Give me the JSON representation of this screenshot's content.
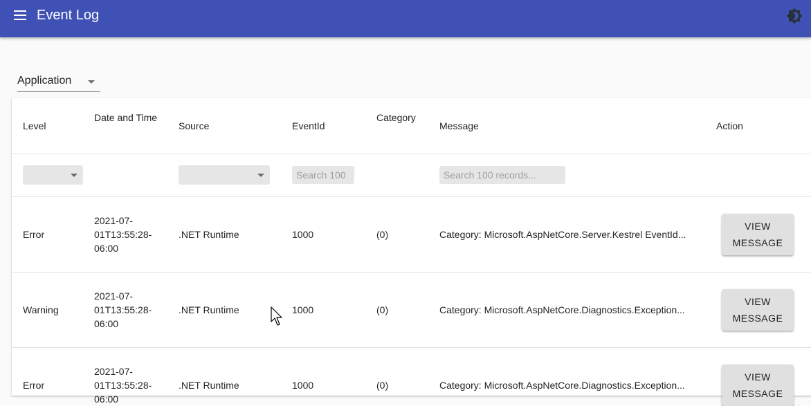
{
  "app": {
    "title": "Event Log"
  },
  "log_selector": {
    "value": "Application"
  },
  "table": {
    "headers": {
      "level": "Level",
      "date": "Date and Time",
      "source": "Source",
      "eventid": "EventId",
      "category": "Category",
      "message": "Message",
      "action": "Action"
    },
    "filters": {
      "eventid_placeholder": "Search 100",
      "message_placeholder": "Search 100 records..."
    },
    "rows": [
      {
        "level": "Error",
        "date_line1": "2021-07-",
        "date_line2": "01T13:55:28-",
        "date_line3": "06:00",
        "source": ".NET Runtime",
        "eventid": "1000",
        "category": "(0)",
        "message": "Category: Microsoft.AspNetCore.Server.Kestrel EventId...",
        "action_line1": "VIEW",
        "action_line2": "MESSAGE"
      },
      {
        "level": "Warning",
        "date_line1": "2021-07-",
        "date_line2": "01T13:55:28-",
        "date_line3": "06:00",
        "source": ".NET Runtime",
        "eventid": "1000",
        "category": "(0)",
        "message": "Category: Microsoft.AspNetCore.Diagnostics.Exception...",
        "action_line1": "VIEW",
        "action_line2": "MESSAGE"
      },
      {
        "level": "Error",
        "date_line1": "2021-07-",
        "date_line2": "01T13:55:28-",
        "date_line3": "06:00",
        "source": ".NET Runtime",
        "eventid": "1000",
        "category": "(0)",
        "message": "Category: Microsoft.AspNetCore.Diagnostics.Exception...",
        "action_line1": "VIEW",
        "action_line2": "MESSAGE"
      }
    ]
  },
  "icons": {
    "menu": "menu-icon",
    "theme": "brightness-icon",
    "dropdown": "arrow-drop-down-icon",
    "cursor": "mouse-pointer-icon"
  },
  "colors": {
    "appbar": "#3f51b5",
    "button": "#e0e0e0",
    "filter_bg": "#e6e6e6"
  }
}
